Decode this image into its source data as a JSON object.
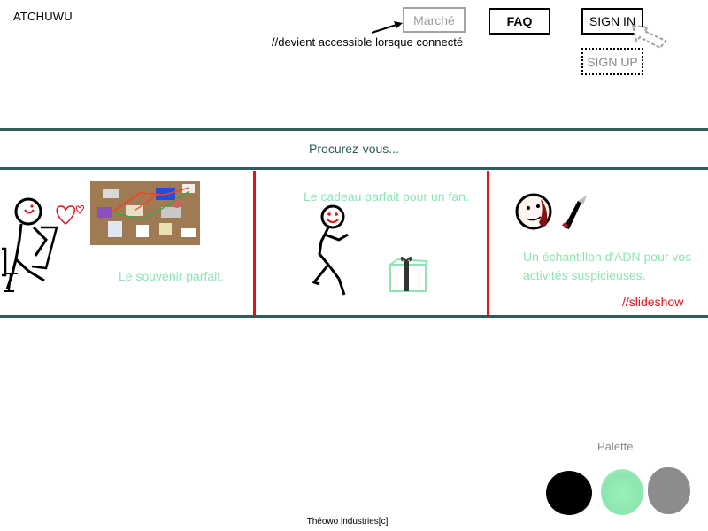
{
  "header": {
    "brand": "ATCHUWU",
    "market_button": "Marché",
    "faq_button": "FAQ",
    "signin_button": "SIGN IN",
    "signup_button": "SIGN UP",
    "market_note": "//devient accessible lorsque connecté"
  },
  "banner": {
    "title": "Procurez-vous...",
    "slides": [
      {
        "caption": "Le souvenir parfait."
      },
      {
        "caption": "Le cadeau parfait pour un fan."
      },
      {
        "caption": "Un échantillon d'ADN pour vos activités suspicieuses."
      }
    ],
    "slideshow_note": "//slideshow"
  },
  "palette": {
    "label": "Palette",
    "colors": [
      "#000000",
      "#8de5b2",
      "#8c8c8c"
    ]
  },
  "footer": {
    "text": "Théowo industries[c]"
  },
  "colors": {
    "accent_teal": "#2e5e59",
    "divider_red": "#e0141b",
    "caption_green": "#8de5b2"
  }
}
